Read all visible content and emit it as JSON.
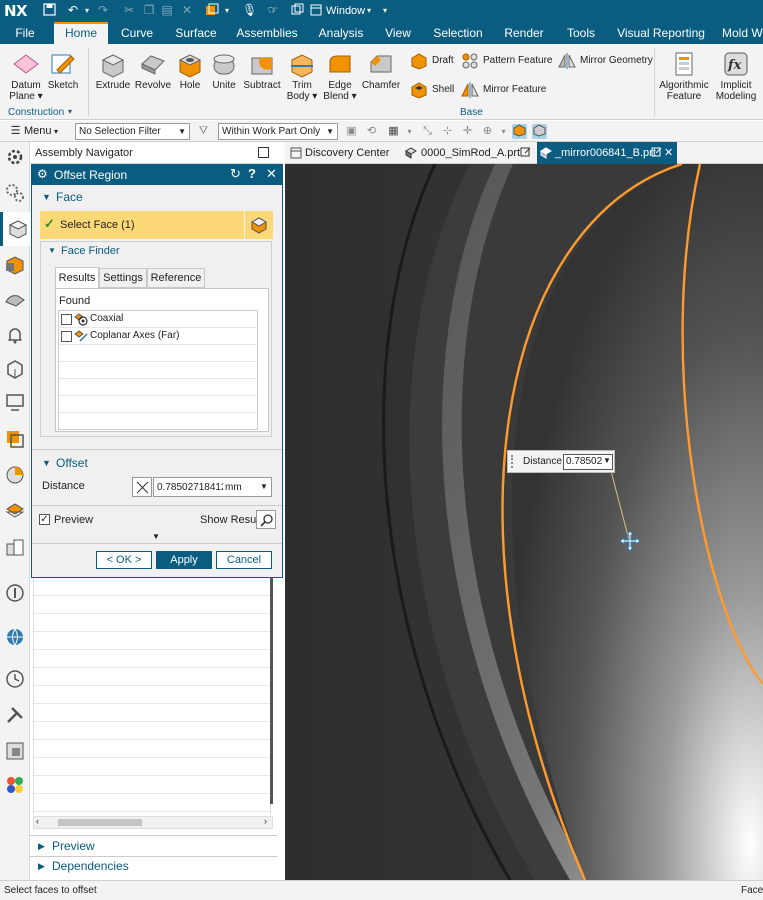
{
  "app": {
    "logo": "NX",
    "window_menu": "Window"
  },
  "menu_tabs": [
    "File",
    "Home",
    "Curve",
    "Surface",
    "Assemblies",
    "Analysis",
    "View",
    "Selection",
    "Render",
    "Tools",
    "Visual Reporting",
    "Mold W"
  ],
  "ribbon": {
    "datum_plane": "Datum Plane",
    "sketch": "Sketch",
    "construction_group": "Construction",
    "extrude": "Extrude",
    "revolve": "Revolve",
    "hole": "Hole",
    "unite": "Unite",
    "subtract": "Subtract",
    "trim_body": "Trim Body",
    "edge_blend": "Edge Blend",
    "chamfer": "Chamfer",
    "draft": "Draft",
    "shell": "Shell",
    "pattern_feature": "Pattern Feature",
    "mirror_feature": "Mirror Feature",
    "mirror_geometry": "Mirror Geometry",
    "base_group": "Base",
    "algorithmic_feature": "Algorithmic Feature",
    "implicit_modeling": "Implicit Modeling"
  },
  "toolbar2": {
    "menu": "Menu",
    "selection_filter": "No Selection Filter",
    "scope": "Within Work Part Only"
  },
  "navigator": {
    "title": "Assembly Navigator"
  },
  "doc_tabs": [
    "Discovery Center",
    "0000_SimRod_A.prt",
    "_mirror006841_B.prt"
  ],
  "dialog": {
    "title": "Offset Region",
    "face_section": "Face",
    "select_face": "Select Face (1)",
    "face_finder": "Face Finder",
    "tabs": [
      "Results",
      "Settings",
      "Reference"
    ],
    "found_label": "Found",
    "found_items": [
      "Coaxial",
      "Coplanar Axes (Far)"
    ],
    "offset_section": "Offset",
    "distance_label": "Distance",
    "distance_value": "0.78502718412",
    "distance_unit": "mm",
    "preview_label": "Preview",
    "show_result": "Show Result",
    "ok": "< OK >",
    "apply": "Apply",
    "cancel": "Cancel"
  },
  "nav_bottom": {
    "preview": "Preview",
    "dependencies": "Dependencies"
  },
  "viewport": {
    "distance_label": "Distance",
    "distance_value": "0.78502"
  },
  "status": {
    "left": "Select faces to offset",
    "right": "Face"
  },
  "colors": {
    "accent": "#0a5d80",
    "highlight": "#f39200",
    "select_bg": "#fdd877"
  }
}
